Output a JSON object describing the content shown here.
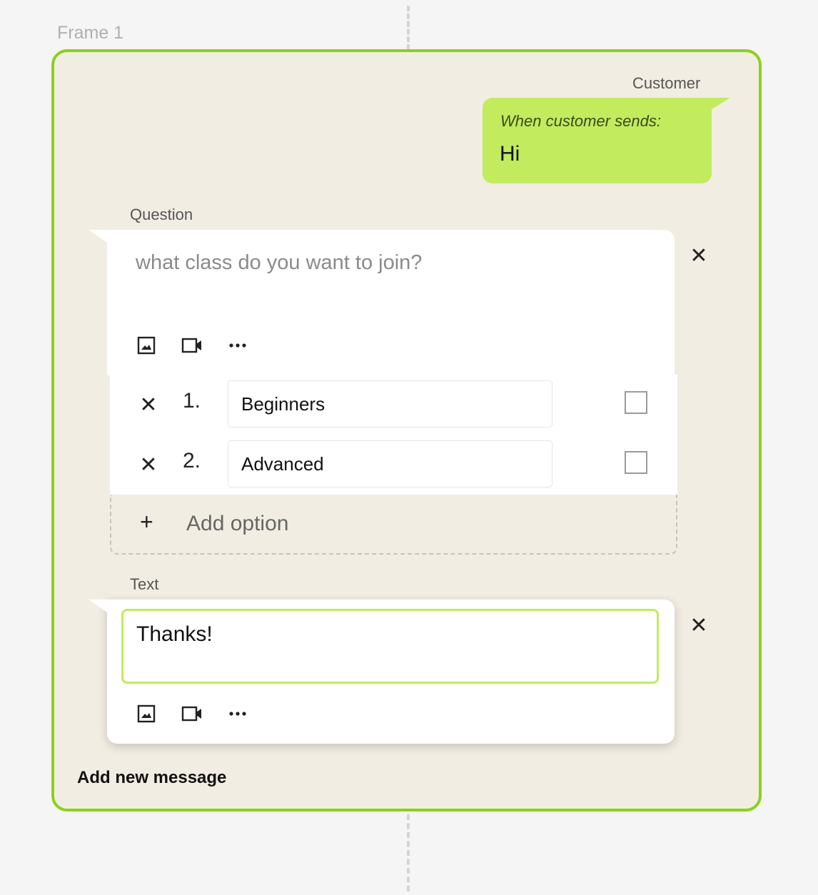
{
  "frame": {
    "label": "Frame 1"
  },
  "customer": {
    "label": "Customer",
    "trigger_label": "When customer sends:",
    "message": "Hi"
  },
  "question_block": {
    "label": "Question",
    "text": "what class do you want to join?",
    "options": [
      {
        "number": "1.",
        "value": "Beginners",
        "checked": false
      },
      {
        "number": "2.",
        "value": "Advanced",
        "checked": false
      }
    ],
    "add_option_label": "Add option"
  },
  "text_block": {
    "label": "Text",
    "text": "Thanks!"
  },
  "add_new_message_label": "Add new message",
  "glyphs": {
    "close": "✕",
    "plus": "+"
  },
  "colors": {
    "frame_border": "#8ad11a",
    "bubble": "#c2eb5e",
    "frame_bg": "#f2ede2"
  },
  "icons": [
    "image-icon",
    "video-icon",
    "more-icon"
  ]
}
